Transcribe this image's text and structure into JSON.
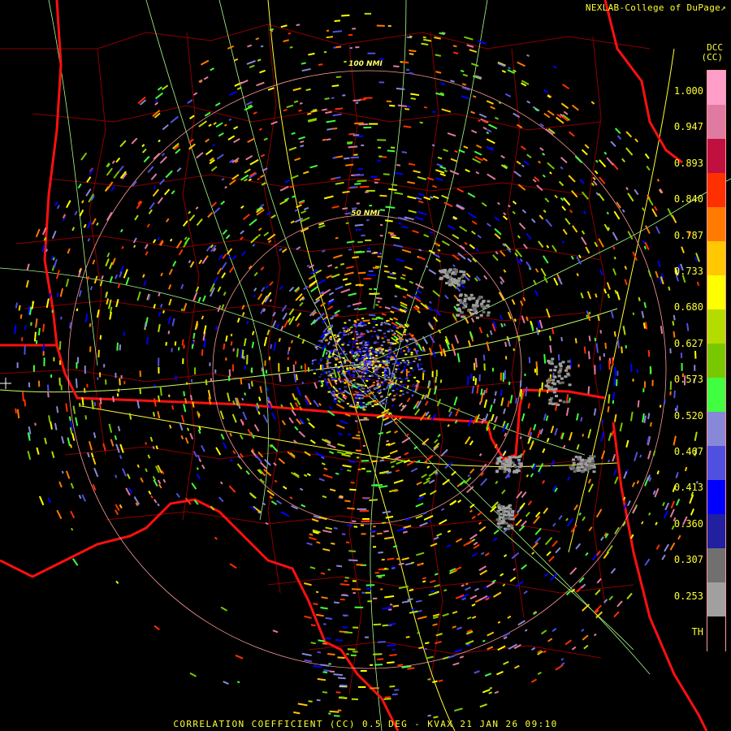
{
  "header": {
    "credit": "NEXLAB-College of DuPage",
    "credit_mark": "↗",
    "product_code": "DCC",
    "product_unit": "(CC)"
  },
  "legend": {
    "labels": [
      "1.000",
      "0.947",
      "0.893",
      "0.840",
      "0.787",
      "0.733",
      "0.680",
      "0.627",
      "0.573",
      "0.520",
      "0.467",
      "0.413",
      "0.360",
      "0.307",
      "0.253",
      "TH"
    ],
    "colors": [
      "#ff9ec8",
      "#e07aa0",
      "#c01040",
      "#ff3000",
      "#ff7a00",
      "#ffc800",
      "#ffff00",
      "#b4dc00",
      "#78c800",
      "#40ff40",
      "#8888d8",
      "#5050e0",
      "#0000ff",
      "#2020a0",
      "#707070",
      "#a0a0a0",
      "#000000"
    ]
  },
  "range_rings": [
    {
      "label": "50 NMI"
    },
    {
      "label": "100 NMI"
    }
  ],
  "caption": "CORRELATION COEFFICIENT (CC) 0.5 DEG - KVAX 21 JAN 26 09:10"
}
